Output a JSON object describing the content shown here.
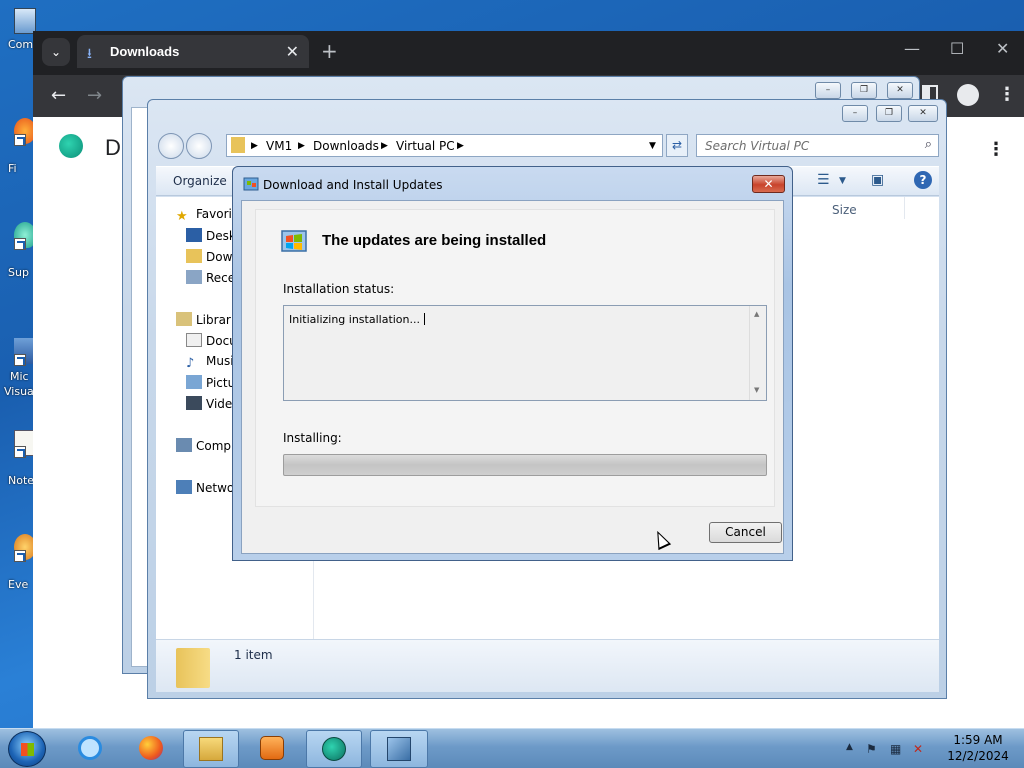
{
  "desktop": {
    "icons": [
      {
        "label": "Com",
        "icon": "computer-icon"
      },
      {
        "label": "Fi",
        "icon": "firefox-icon"
      },
      {
        "label": "Sup",
        "icon": "app-shortcut-icon"
      },
      {
        "label": "Mic",
        "icon": "visual-studio-icon"
      },
      {
        "label": "Visua",
        "icon": "visual-studio-icon"
      },
      {
        "label": "Note",
        "icon": "notepad-icon"
      },
      {
        "label": "Eve",
        "icon": "app-shortcut-icon"
      }
    ]
  },
  "browser": {
    "tab_title": "Downloads",
    "tab_icon": "download-icon",
    "page_heading": "D"
  },
  "explorer": {
    "breadcrumb": [
      "VM1",
      "Downloads",
      "Virtual PC"
    ],
    "search_placeholder": "Search Virtual PC",
    "organize_label": "Organize",
    "column_size": "Size",
    "nav": {
      "favorites": "Favorit",
      "desktop": "Desk",
      "downloads": "Dow",
      "recent": "Rece",
      "libraries": "Librarie",
      "documents": "Docu",
      "music": "Musi",
      "pictures": "Pictu",
      "videos": "Video",
      "computer": "Compu",
      "network": "Netwo"
    },
    "item_count": "1 item"
  },
  "dialog": {
    "title": "Download and Install Updates",
    "heading": "The updates are being installed",
    "status_label": "Installation status:",
    "status_text": "Initializing installation...",
    "progress_label": "Installing:",
    "progress_percent": 0,
    "cancel_label": "Cancel"
  },
  "taskbar": {
    "pinned": [
      "ie-icon",
      "firefox-icon",
      "explorer-icon",
      "media-player-icon",
      "app-icon",
      "windows-update-icon"
    ],
    "time": "1:59 AM",
    "date": "12/2/2024"
  },
  "colors": {
    "accent": "#1a5fb0",
    "progress_fill": "#2fb12c"
  }
}
